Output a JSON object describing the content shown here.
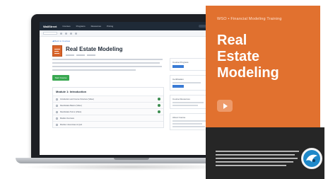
{
  "screen": {
    "app": {
      "logo": "WallStreet",
      "nav": [
        "Courses",
        "Programs",
        "Resources",
        "Pricing"
      ]
    },
    "breadcrumb": "◀ Back to Courses",
    "course": {
      "title": "Real Estate Modeling",
      "start_label": "Start Course"
    },
    "module": {
      "title": "Module 1: Introduction",
      "rows": [
        "Introduction and Course Structure (Video)",
        "Real Estate Basics (Video)",
        "Real Estate Terms (Video)",
        "Models Overview",
        "Module 1 Exercises & Quiz"
      ]
    },
    "side": {
      "labels": [
        "Course Progress",
        "Certification",
        "Course Resources",
        "About Course"
      ]
    }
  },
  "cover": {
    "overline": "WSO • Financial Modeling Training",
    "title_lines": [
      "Real",
      "Estate",
      "Modeling"
    ],
    "accent_color": "#e1712f"
  },
  "dark_panel": {
    "color": "#262626"
  },
  "icons": {
    "play": "play-icon",
    "brand": "brand-logo-icon"
  }
}
